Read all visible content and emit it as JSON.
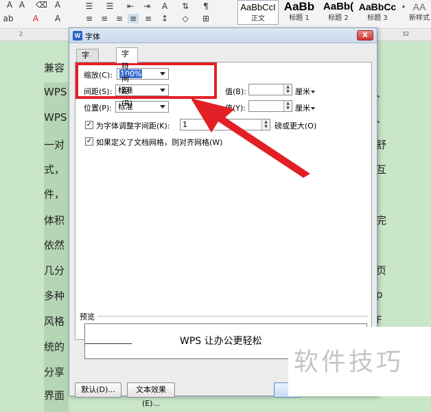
{
  "ribbon": {
    "styles": [
      {
        "sample": "AaBbCcI",
        "label": "正文",
        "active": true
      },
      {
        "sample": "AaBb",
        "label": "标题 1"
      },
      {
        "sample": "AaBb(",
        "label": "标题 2"
      },
      {
        "sample": "AaBbCc",
        "label": "标题 3"
      },
      {
        "sample": "AA",
        "label": "新样式"
      }
    ]
  },
  "ruler": {
    "marks": [
      "2",
      "32"
    ]
  },
  "document": {
    "lines": [
      "兼容",
      "WPS",
      "WPS",
      "一对",
      "式，",
      "件，",
      "体积",
      "依然",
      "几分",
      "多种",
      "风格",
      "统的",
      "分享",
      "界面"
    ],
    "right_fragments": [
      "、",
      "、",
      "舒",
      "互",
      "完",
      "页",
      "p",
      "F"
    ]
  },
  "dialog": {
    "title": "字体",
    "close": "X",
    "tabs": [
      "字体(N)",
      "字符间距(R)"
    ],
    "scale_label": "缩放(C):",
    "scale_value": "100%",
    "spacing_label": "间距(S):",
    "spacing_value": "标准",
    "position_label": "位置(P):",
    "position_value": "标准",
    "value_b_label": "值(B):",
    "value_y_label": "值(Y):",
    "unit": "厘米",
    "kerning_label": "为字体调整字间距(K):",
    "kerning_value": "1",
    "kerning_suffix": "磅或更大(O)",
    "grid_label": "如果定义了文档网格，则对齐网格(W)",
    "preview_label": "预览",
    "preview_text": "WPS 让办公更轻松",
    "btn_default": "默认(D)...",
    "btn_effects": "文本效果(E)..."
  },
  "watermark": "软件技巧",
  "colors": {
    "highlight": "#e31f26",
    "doc_background": "#c9e6c9",
    "accent": "#3b73d3"
  }
}
